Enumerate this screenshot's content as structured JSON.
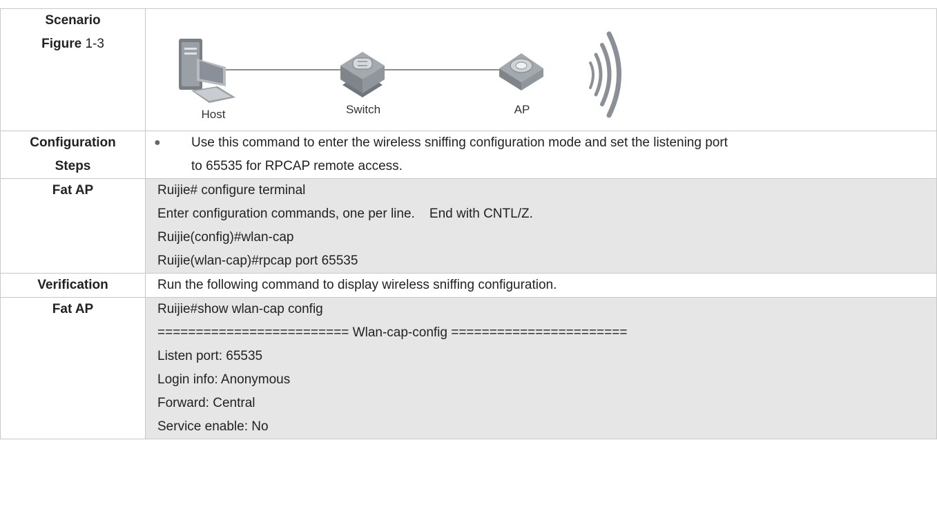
{
  "scenario": {
    "label_line1": "Scenario",
    "label_figure": "Figure",
    "label_figure_num": "1-3",
    "devices": {
      "host": "Host",
      "switch": "Switch",
      "ap": "AP"
    }
  },
  "config_steps": {
    "label_line1": "Configuration",
    "label_line2": "Steps",
    "bullet": "●",
    "text_line1": "Use this command to enter the wireless sniffing configuration mode and set the listening port",
    "text_line2": "to 65535 for RPCAP remote access."
  },
  "fat_ap_1": {
    "label": "Fat AP",
    "lines": [
      "Ruijie# configure terminal",
      "Enter configuration commands, one per line.    End with CNTL/Z.",
      "Ruijie(config)#wlan-cap",
      "Ruijie(wlan-cap)#rpcap port 65535"
    ]
  },
  "verification": {
    "label": "Verification",
    "text": "Run the following command to display wireless sniffing configuration."
  },
  "fat_ap_2": {
    "label": "Fat AP",
    "lines": [
      "Ruijie#show wlan-cap config",
      "========================= Wlan-cap-config =======================",
      "Listen port: 65535",
      "Login info: Anonymous",
      "Forward: Central",
      "Service enable: No"
    ]
  }
}
